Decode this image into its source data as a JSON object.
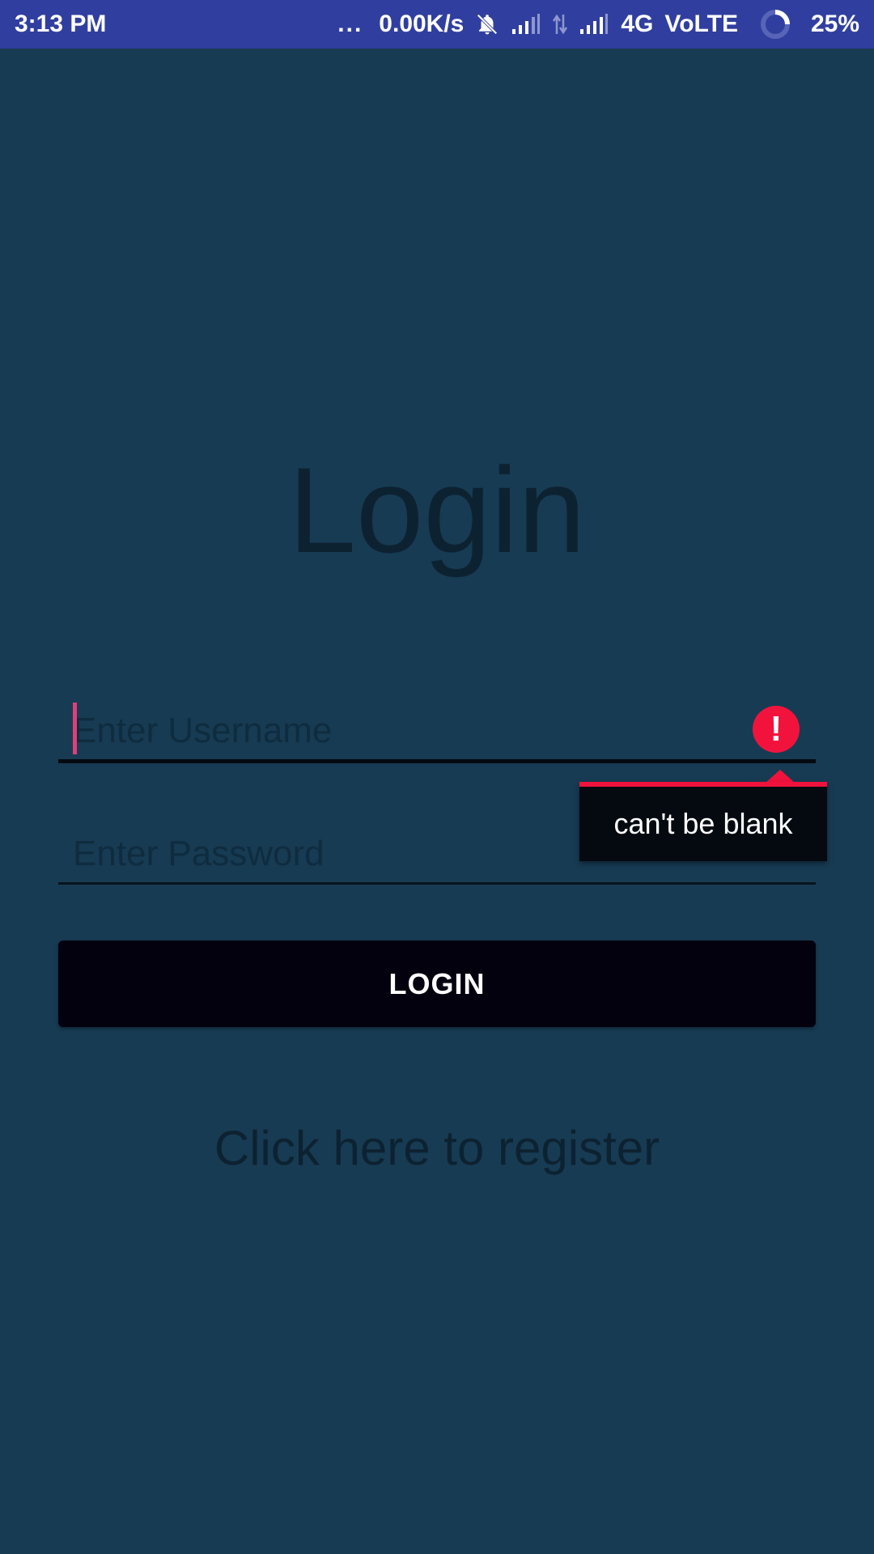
{
  "status_bar": {
    "time": "3:13 PM",
    "dots": "...",
    "speed": "0.00K/s",
    "network": "4G",
    "volte": "VoLTE",
    "battery": "25%",
    "icons": [
      "notifications-off-icon",
      "signal-icon",
      "data-arrows-icon",
      "signal-icon",
      "battery-ring-icon"
    ]
  },
  "login": {
    "title": "Login",
    "username_placeholder": "Enter Username",
    "password_placeholder": "Enter Password",
    "error_message": "can't be blank",
    "error_icon_glyph": "!",
    "button_label": "LOGIN",
    "register_link": "Click here to register"
  },
  "colors": {
    "background": "#173b53",
    "status_bar": "#303f9f",
    "error": "#f2133d",
    "button": "#04010f",
    "text_dark": "#0d2231"
  }
}
